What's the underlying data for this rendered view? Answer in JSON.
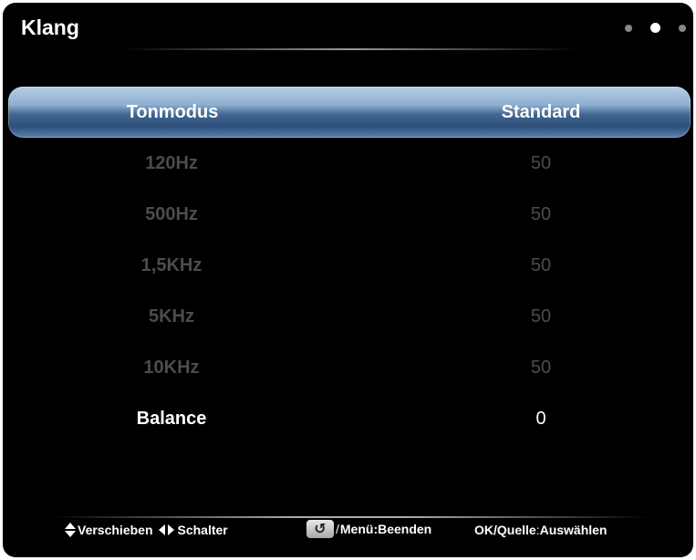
{
  "header": {
    "title": "Klang",
    "page_dots": 3,
    "active_dot": 2
  },
  "menu": {
    "selected": {
      "label": "Tonmodus",
      "value": "Standard"
    },
    "items": [
      {
        "label": "120Hz",
        "value": "50"
      },
      {
        "label": "500Hz",
        "value": "50"
      },
      {
        "label": "1,5KHz",
        "value": "50"
      },
      {
        "label": "5KHz",
        "value": "50"
      },
      {
        "label": "10KHz",
        "value": "50"
      },
      {
        "label": "Balance",
        "value": "0"
      }
    ]
  },
  "footer": {
    "move_label": "Verschieben",
    "switch_label": "Schalter",
    "back_icon": "↺",
    "slash": "/",
    "menu_exit_label": "Menü:Beenden",
    "ok_key": "OK/Quelle",
    "colon": ":",
    "select_label": "Auswählen"
  },
  "colors": {
    "highlight": "#5f86b1",
    "dim_text": "#4c4c4c",
    "background": "#000000"
  }
}
